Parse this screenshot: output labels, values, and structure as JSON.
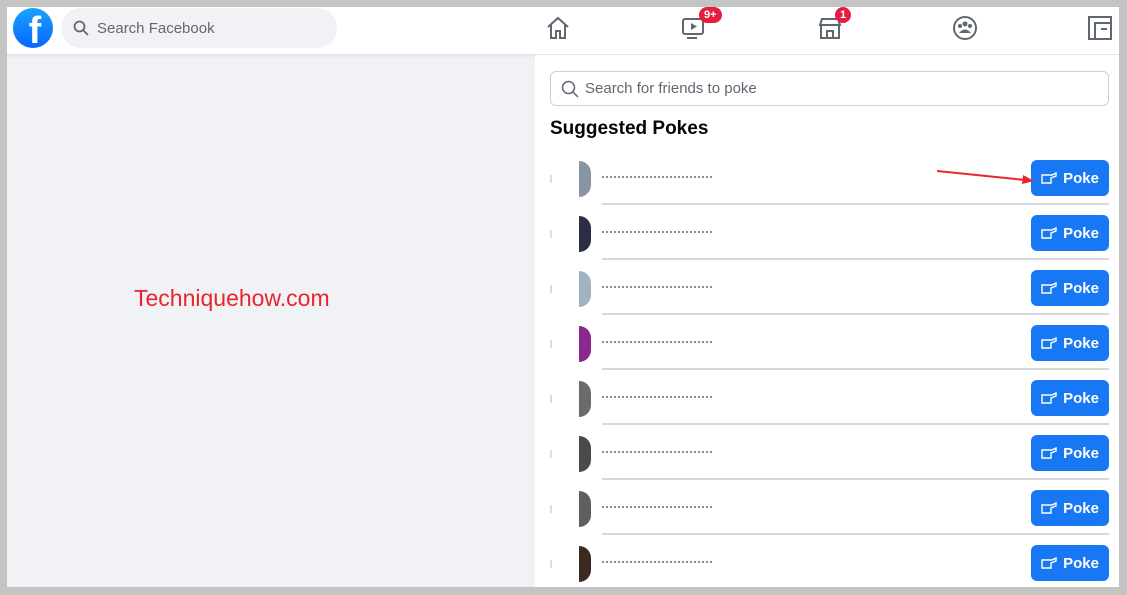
{
  "topbar": {
    "logo": "f",
    "search_placeholder": "Search Facebook",
    "nav": [
      {
        "icon": "home-icon",
        "badge": null
      },
      {
        "icon": "watch-icon",
        "badge": "9+"
      },
      {
        "icon": "marketplace-icon",
        "badge": "1"
      },
      {
        "icon": "groups-icon",
        "badge": null
      },
      {
        "icon": "gaming-icon",
        "badge": null
      }
    ]
  },
  "watermark": "Techniquehow.com",
  "pokes": {
    "search_placeholder": "Search for friends to poke",
    "heading": "Suggested Pokes",
    "button_label": "Poke",
    "items": [
      {
        "name": "",
        "avatar_color": "#8a95a3"
      },
      {
        "name": "",
        "avatar_color": "#2a2f45"
      },
      {
        "name": "",
        "avatar_color": "#9fb4c0"
      },
      {
        "name": "",
        "avatar_color": "#8a2a8f"
      },
      {
        "name": "",
        "avatar_color": "#6b6b6b"
      },
      {
        "name": "",
        "avatar_color": "#4c4a48"
      },
      {
        "name": "",
        "avatar_color": "#5e5e5e"
      },
      {
        "name": "",
        "avatar_color": "#3b2a22"
      }
    ]
  },
  "colors": {
    "accent": "#1877f2",
    "badge": "#e41e3f",
    "annotation": "#e9242b"
  }
}
